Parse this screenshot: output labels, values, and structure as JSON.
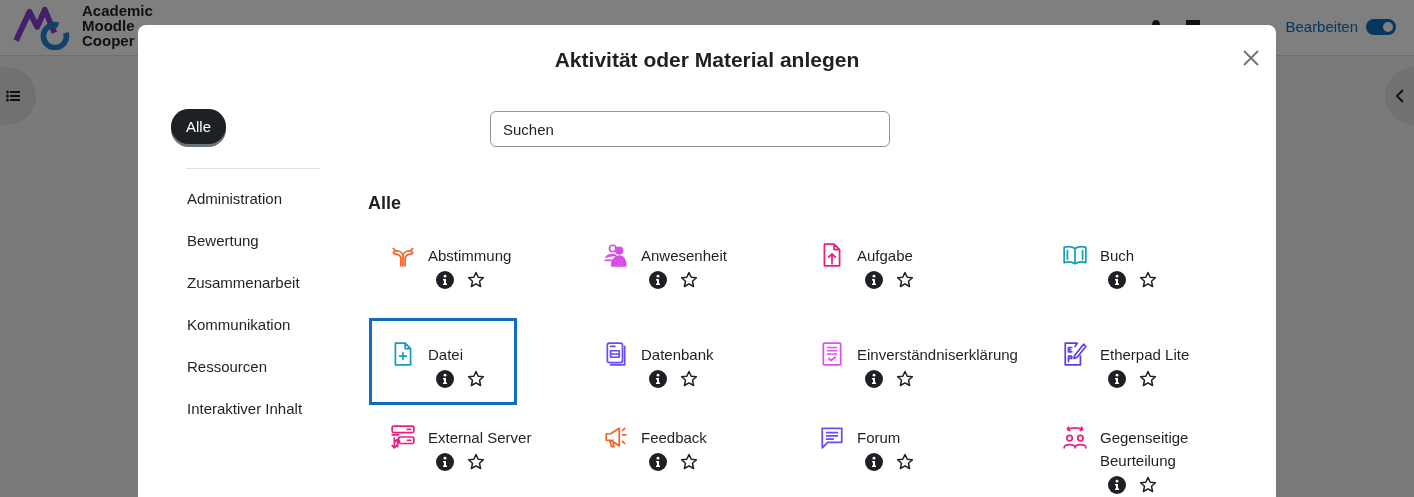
{
  "header": {
    "logo_lines": [
      "Academic",
      "Moodle",
      "Cooper"
    ],
    "edit_mode": {
      "label": "Bearbeiten",
      "on": true
    }
  },
  "modal": {
    "title": "Aktivität oder Material anlegen",
    "filter_tabs": [
      {
        "label": "Alle",
        "selected": true
      }
    ],
    "categories": [
      "Administration",
      "Bewertung",
      "Zusammenarbeit",
      "Kommunikation",
      "Ressourcen",
      "Interaktiver Inhalt"
    ],
    "search": {
      "placeholder": "Suchen"
    },
    "section_title": "Alle",
    "activities": [
      {
        "name": "Abstimmung",
        "kind": "choice",
        "color": "#f7631f",
        "selected": false
      },
      {
        "name": "Anwesenheit",
        "kind": "attendance",
        "color": "#d94ee3",
        "selected": false
      },
      {
        "name": "Aufgabe",
        "kind": "assignment",
        "color": "#ec1f7d",
        "selected": false
      },
      {
        "name": "Buch",
        "kind": "book",
        "color": "#11a0b6",
        "selected": false
      },
      {
        "name": "Datei",
        "kind": "file",
        "color": "#11a0b6",
        "selected": true
      },
      {
        "name": "Datenbank",
        "kind": "database",
        "color": "#6b4bf5",
        "selected": false
      },
      {
        "name": "Einverständniserklärung",
        "kind": "consent",
        "color": "#e04df0",
        "selected": false
      },
      {
        "name": "Etherpad Lite",
        "kind": "etherpad",
        "color": "#5b3ee8",
        "selected": false
      },
      {
        "name": "External Server",
        "kind": "server",
        "color": "#ec1f7d",
        "selected": false
      },
      {
        "name": "Feedback",
        "kind": "feedback",
        "color": "#f7631f",
        "selected": false
      },
      {
        "name": "Forum",
        "kind": "forum",
        "color": "#6b4bf5",
        "selected": false
      },
      {
        "name": "Gegenseitige Beurteilung",
        "kind": "workshop",
        "color": "#ec1f7d",
        "selected": false
      }
    ]
  }
}
